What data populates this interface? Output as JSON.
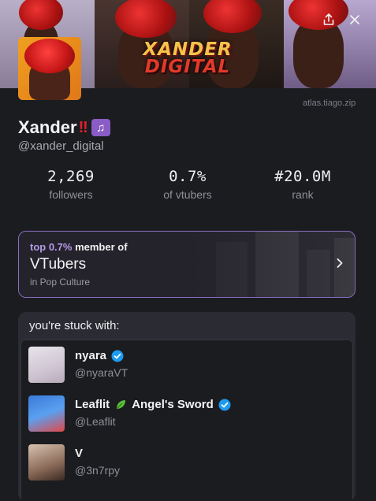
{
  "banner": {
    "logo_line1": "XANDER",
    "logo_line2": "DIGITAL"
  },
  "site_link": "atlas.tiago.zip",
  "profile": {
    "name": "Xander",
    "name_emoji_bang": "‼",
    "name_emoji_notes": "♫",
    "handle": "@xander_digital"
  },
  "stats": [
    {
      "value": "2,269",
      "label": "followers"
    },
    {
      "value": "0.7%",
      "label": "of vtubers"
    },
    {
      "value": "#20.0M",
      "label": "rank"
    }
  ],
  "community": {
    "top_percent": "top 0.7%",
    "top_suffix": " member of",
    "title": "VTubers",
    "subtitle": "in Pop Culture"
  },
  "stuck_with": {
    "heading": "you're stuck with:",
    "users": [
      {
        "name": "nyara",
        "handle": "@nyaraVT",
        "verified": true
      },
      {
        "name_part1": "Leaflit",
        "name_part2": "Angel's Sword",
        "handle": "@Leaflit",
        "verified": true
      },
      {
        "name": "V",
        "handle": "@3n7rpy",
        "verified": false
      }
    ]
  },
  "colors": {
    "accent_purple": "#8c6fc4",
    "verified_blue": "#1d9bf0",
    "background": "#1b1c20"
  },
  "icons": [
    "share-icon",
    "close-icon",
    "chevron-right-icon",
    "verified-badge-icon",
    "leaf-icon"
  ]
}
